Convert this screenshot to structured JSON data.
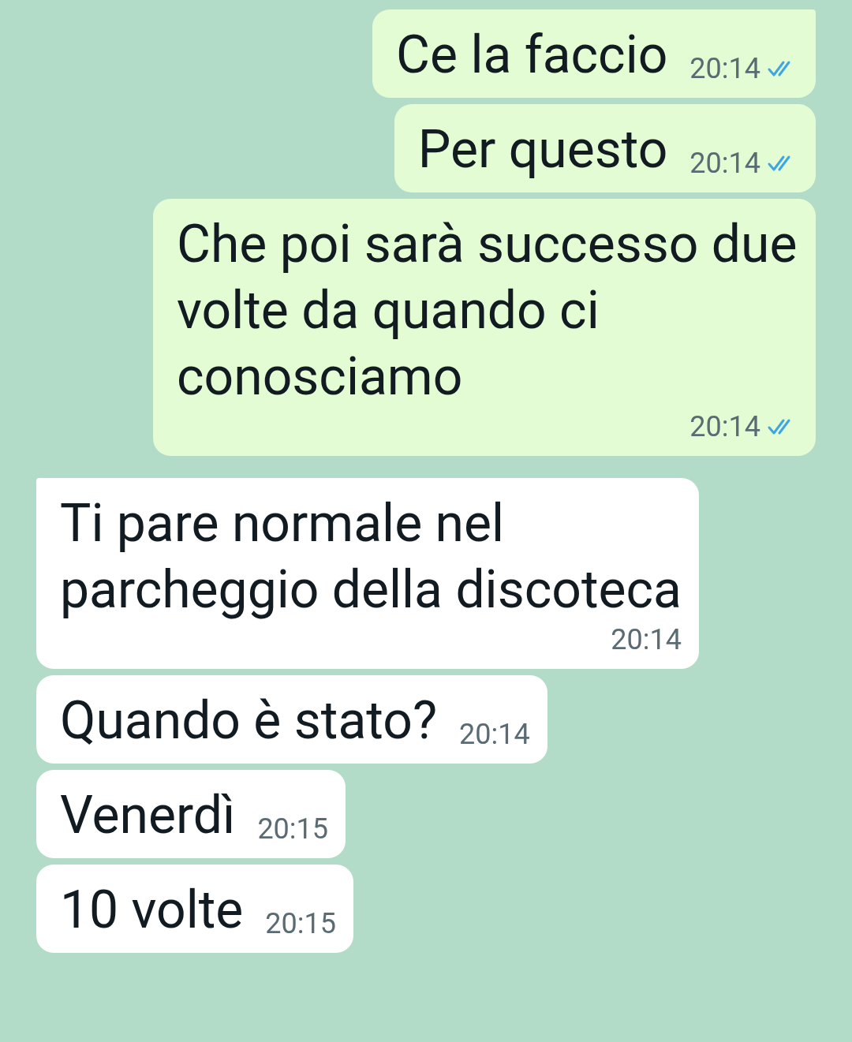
{
  "messages": [
    {
      "kind": "outgoing",
      "first_in_group": true,
      "text": "Ce la faccio",
      "time": "20:14",
      "read": true
    },
    {
      "kind": "outgoing",
      "first_in_group": false,
      "text": "Per questo",
      "time": "20:14",
      "read": true
    },
    {
      "kind": "outgoing",
      "first_in_group": false,
      "text": "Che poi sarà successo due volte da quando ci conosciamo",
      "time": "20:14",
      "read": true
    },
    {
      "kind": "incoming",
      "first_in_group": true,
      "text": "Ti pare normale nel parcheggio della discoteca",
      "time": "20:14"
    },
    {
      "kind": "incoming",
      "first_in_group": false,
      "text": "Quando è stato?",
      "time": "20:14"
    },
    {
      "kind": "incoming",
      "first_in_group": false,
      "text": "Venerdì",
      "time": "20:15"
    },
    {
      "kind": "incoming",
      "first_in_group": false,
      "text": "10 volte",
      "time": "20:15"
    }
  ]
}
